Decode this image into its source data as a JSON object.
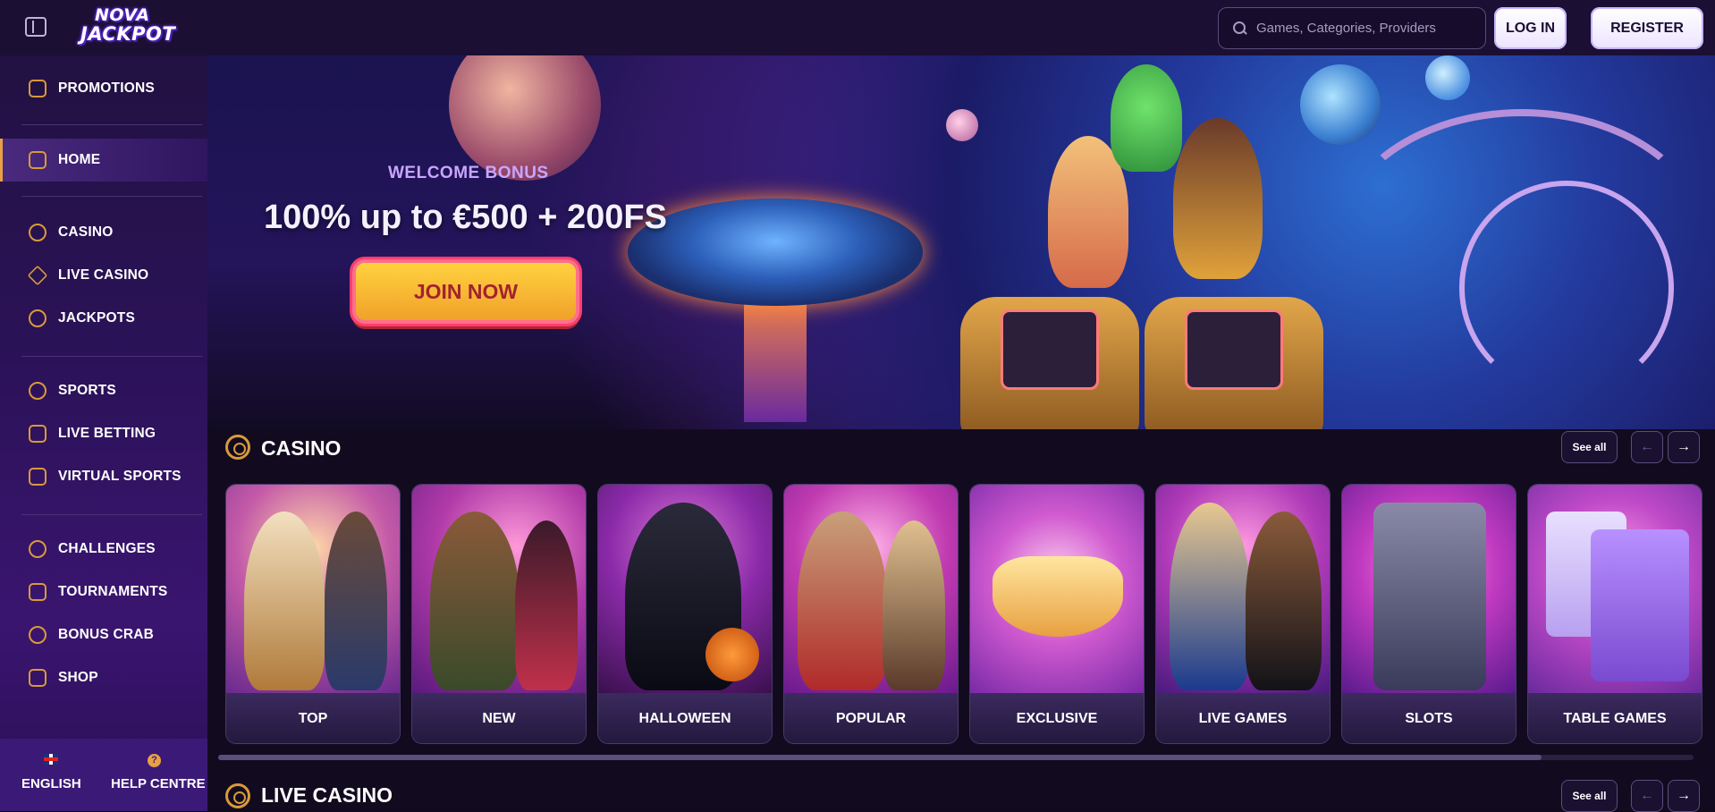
{
  "header": {
    "logo_line1": "NOVA",
    "logo_line2": "JACKPOT",
    "search_placeholder": "Games, Categories, Providers",
    "login_label": "LOG IN",
    "register_label": "REGISTER"
  },
  "sidebar": {
    "items": [
      {
        "label": "PROMOTIONS",
        "icon": "gift-icon"
      },
      {
        "label": "HOME",
        "icon": "home-icon",
        "active": true
      },
      {
        "label": "CASINO",
        "icon": "chip-icon"
      },
      {
        "label": "LIVE CASINO",
        "icon": "spade-icon"
      },
      {
        "label": "JACKPOTS",
        "icon": "seven-icon"
      },
      {
        "label": "SPORTS",
        "icon": "football-icon"
      },
      {
        "label": "LIVE BETTING",
        "icon": "play-icon"
      },
      {
        "label": "VIRTUAL SPORTS",
        "icon": "gamepad-icon"
      },
      {
        "label": "CHALLENGES",
        "icon": "medal-icon"
      },
      {
        "label": "TOURNAMENTS",
        "icon": "trophy-icon"
      },
      {
        "label": "BONUS CRAB",
        "icon": "crab-icon"
      },
      {
        "label": "SHOP",
        "icon": "shop-icon"
      }
    ],
    "bottom": {
      "language_label": "ENGLISH",
      "help_label": "HELP CENTRE"
    }
  },
  "hero": {
    "subtitle": "WELCOME BONUS",
    "title": "100% up to €500 + 200FS",
    "cta_label": "JOIN NOW"
  },
  "sections": [
    {
      "title": "CASINO",
      "see_all": "See all",
      "cards": [
        "TOP",
        "NEW",
        "HALLOWEEN",
        "POPULAR",
        "EXCLUSIVE",
        "LIVE GAMES",
        "SLOTS",
        "TABLE GAMES"
      ]
    },
    {
      "title": "LIVE CASINO",
      "see_all": "See all"
    }
  ],
  "colors": {
    "accent_gold": "#e7a144",
    "sidebar_bg": "#2b1258",
    "header_bg": "#1b0f33",
    "cta_yellow": "#ffd23f"
  }
}
